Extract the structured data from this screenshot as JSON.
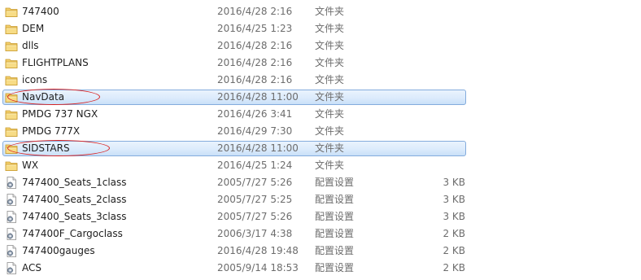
{
  "rows": [
    {
      "name": "747400",
      "date": "2016/4/28 2:16",
      "type": "文件夹",
      "size": "",
      "icon": "folder-icon",
      "selected": false
    },
    {
      "name": "DEM",
      "date": "2016/4/25 1:23",
      "type": "文件夹",
      "size": "",
      "icon": "folder-icon",
      "selected": false
    },
    {
      "name": "dlls",
      "date": "2016/4/28 2:16",
      "type": "文件夹",
      "size": "",
      "icon": "folder-icon",
      "selected": false
    },
    {
      "name": "FLIGHTPLANS",
      "date": "2016/4/28 2:16",
      "type": "文件夹",
      "size": "",
      "icon": "folder-icon",
      "selected": false
    },
    {
      "name": "icons",
      "date": "2016/4/28 2:16",
      "type": "文件夹",
      "size": "",
      "icon": "folder-icon",
      "selected": false
    },
    {
      "name": "NavData",
      "date": "2016/4/28 11:00",
      "type": "文件夹",
      "size": "",
      "icon": "folder-icon",
      "selected": true,
      "circled": true
    },
    {
      "name": "PMDG 737 NGX",
      "date": "2016/4/26 3:41",
      "type": "文件夹",
      "size": "",
      "icon": "folder-icon",
      "selected": false
    },
    {
      "name": "PMDG 777X",
      "date": "2016/4/29 7:30",
      "type": "文件夹",
      "size": "",
      "icon": "folder-icon",
      "selected": false
    },
    {
      "name": "SIDSTARS",
      "date": "2016/4/28 11:00",
      "type": "文件夹",
      "size": "",
      "icon": "folder-icon",
      "selected": true,
      "circled": true
    },
    {
      "name": "WX",
      "date": "2016/4/25 1:24",
      "type": "文件夹",
      "size": "",
      "icon": "folder-icon",
      "selected": false
    },
    {
      "name": "747400_Seats_1class",
      "date": "2005/7/27 5:26",
      "type": "配置设置",
      "size": "3 KB",
      "icon": "settings-file-icon",
      "selected": false
    },
    {
      "name": "747400_Seats_2class",
      "date": "2005/7/27 5:25",
      "type": "配置设置",
      "size": "3 KB",
      "icon": "settings-file-icon",
      "selected": false
    },
    {
      "name": "747400_Seats_3class",
      "date": "2005/7/27 5:26",
      "type": "配置设置",
      "size": "3 KB",
      "icon": "settings-file-icon",
      "selected": false
    },
    {
      "name": "747400F_Cargoclass",
      "date": "2006/3/17 4:38",
      "type": "配置设置",
      "size": "2 KB",
      "icon": "settings-file-icon",
      "selected": false
    },
    {
      "name": "747400gauges",
      "date": "2016/4/28 19:48",
      "type": "配置设置",
      "size": "2 KB",
      "icon": "settings-file-icon",
      "selected": false
    },
    {
      "name": "ACS",
      "date": "2005/9/14 18:53",
      "type": "配置设置",
      "size": "2 KB",
      "icon": "settings-file-icon",
      "selected": false
    }
  ],
  "colors": {
    "selection_border": "#84acdd",
    "selection_fill": "#dcebfc",
    "annotation": "#d92020",
    "folder": "#e8b84a"
  }
}
